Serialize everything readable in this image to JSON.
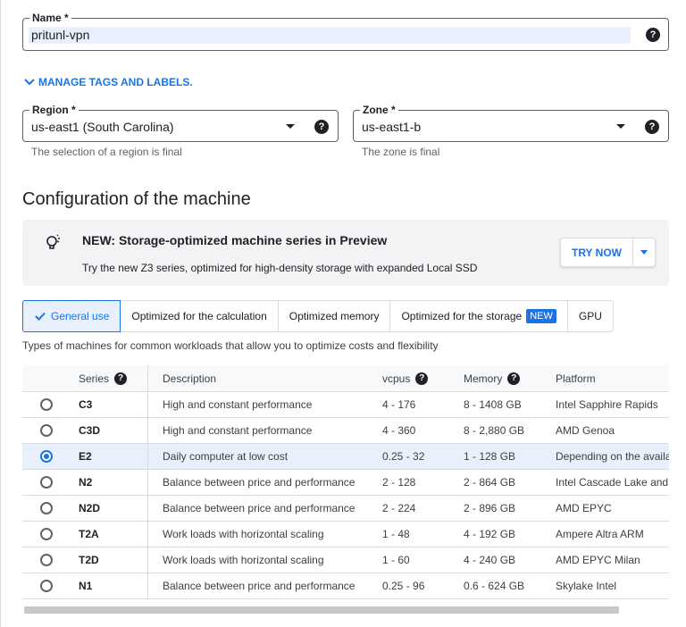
{
  "name_field": {
    "label": "Name *",
    "value": "pritunl-vpn"
  },
  "manage_tags": {
    "label": "MANAGE TAGS AND LABELS."
  },
  "region_field": {
    "label": "Region *",
    "value": "us-east1 (South Carolina)",
    "hint": "The selection of a region is final"
  },
  "zone_field": {
    "label": "Zone *",
    "value": "us-east1-b",
    "hint": "The zone is final"
  },
  "section_title": "Configuration of the machine",
  "banner": {
    "title": "NEW: Storage-optimized machine series in Preview",
    "body": "Try the new Z3 series, optimized for high-density storage with expanded Local SSD",
    "button": "TRY NOW"
  },
  "tabs": [
    {
      "label": "General use",
      "active": true
    },
    {
      "label": "Optimized for the calculation"
    },
    {
      "label": "Optimized memory"
    },
    {
      "label": "Optimized for the storage",
      "badge": "NEW"
    },
    {
      "label": "GPU"
    }
  ],
  "tab_description": "Types of machines for common workloads that allow you to optimize costs and flexibility",
  "table": {
    "headers": {
      "series": "Series",
      "description": "Description",
      "vcpus": "vcpus",
      "memory": "Memory",
      "platform": "Platform"
    },
    "rows": [
      {
        "series": "C3",
        "description": "High and constant performance",
        "vcpus": "4 - 176",
        "memory": "8 - 1408 GB",
        "platform": "Intel Sapphire Rapids",
        "selected": false
      },
      {
        "series": "C3D",
        "description": "High and constant performance",
        "vcpus": "4 - 360",
        "memory": "8 - 2,880 GB",
        "platform": "AMD Genoa",
        "selected": false
      },
      {
        "series": "E2",
        "description": "Daily computer at low cost",
        "vcpus": "0.25 - 32",
        "memory": "1 - 128 GB",
        "platform": "Depending on the availa",
        "selected": true
      },
      {
        "series": "N2",
        "description": "Balance between price and performance",
        "vcpus": "2 - 128",
        "memory": "2 - 864 GB",
        "platform": "Intel Cascade Lake and",
        "selected": false
      },
      {
        "series": "N2D",
        "description": "Balance between price and performance",
        "vcpus": "2 - 224",
        "memory": "2 - 896 GB",
        "platform": "AMD EPYC",
        "selected": false
      },
      {
        "series": "T2A",
        "description": "Work loads with horizontal scaling",
        "vcpus": "1 - 48",
        "memory": "4 - 192 GB",
        "platform": "Ampere Altra ARM",
        "selected": false
      },
      {
        "series": "T2D",
        "description": "Work loads with horizontal scaling",
        "vcpus": "1 - 60",
        "memory": "4 - 240 GB",
        "platform": "AMD EPYC Milan",
        "selected": false
      },
      {
        "series": "N1",
        "description": "Balance between price and performance",
        "vcpus": "0.25 - 96",
        "memory": "0.6 - 624 GB",
        "platform": "Skylake Intel",
        "selected": false
      }
    ]
  },
  "icons": {
    "help": "help-circle-icon",
    "dropdown": "dropdown-arrow-icon",
    "lightbulb": "lightbulb-icon",
    "check": "check-icon",
    "chevron": "chevron-down-icon"
  },
  "colors": {
    "accent": "#1a73e8",
    "selected_row": "#e8f0fe",
    "banner_bg": "#f1f3f4",
    "text": "#202124"
  }
}
